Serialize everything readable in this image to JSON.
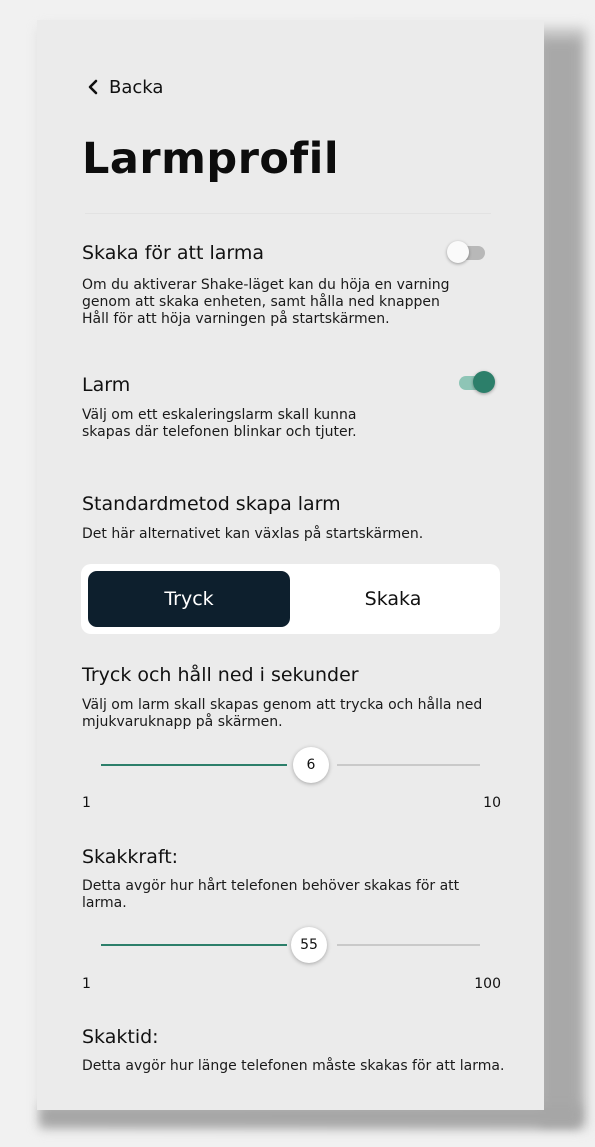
{
  "header": {
    "back_label": "Backa",
    "title": "Larmprofil"
  },
  "shake_to_alarm": {
    "title": "Skaka för att larma",
    "description": "Om du aktiverar Shake-läget kan du höja en varning genom att skaka enheten, samt hålla ned knappen Håll för att höja varningen på startskärmen.",
    "enabled": false
  },
  "alarm": {
    "title": "Larm",
    "description": "Välj om ett eskaleringslarm skall kunna skapas där telefonen blinkar och tjuter.",
    "enabled": true
  },
  "default_method": {
    "title": "Standardmetod skapa larm",
    "description": "Det här alternativet kan växlas på startskärmen.",
    "options": [
      "Tryck",
      "Skaka"
    ],
    "selected": "Tryck"
  },
  "hold_seconds": {
    "title": "Tryck och håll ned i sekunder",
    "description": "Välj om larm skall skapas genom att trycka och hålla ned mjukvaruknapp på skärmen.",
    "value": "6",
    "min": "1",
    "max": "10"
  },
  "shake_force": {
    "title": "Skakkraft:",
    "description": "Detta avgör hur hårt telefonen behöver skakas för att larma.",
    "value": "55",
    "min": "1",
    "max": "100"
  },
  "shake_time": {
    "title": "Skaktid:",
    "description": "Detta avgör hur länge telefonen måste skakas för att larma."
  },
  "colors": {
    "accent": "#2c7f6a",
    "accent_light": "#8ec5b6",
    "segment_active": "#0d1f2d",
    "background": "#ebebeb"
  },
  "icons": {
    "back": "chevron-left-icon"
  }
}
